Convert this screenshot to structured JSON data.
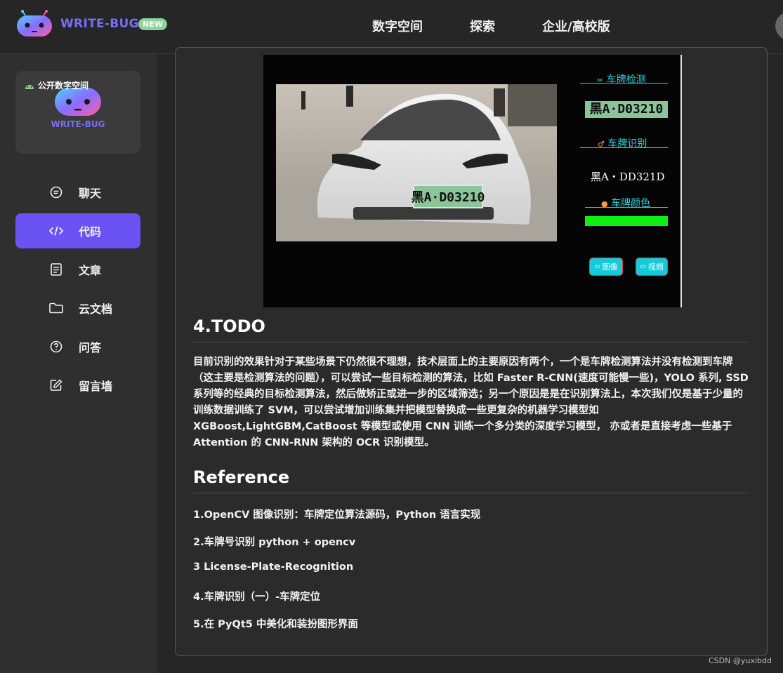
{
  "header": {
    "brand": "WRITE-BUG",
    "badge": "NEW",
    "nav": [
      "数字空间",
      "探索",
      "企业/高校版"
    ]
  },
  "sidebar": {
    "space_card": {
      "tag": "公开数字空间",
      "brand": "WRITE-BUG"
    },
    "items": [
      {
        "label": "聊天",
        "icon": "chat-icon",
        "active": false
      },
      {
        "label": "代码",
        "icon": "code-icon",
        "active": true
      },
      {
        "label": "文章",
        "icon": "article-icon",
        "active": false
      },
      {
        "label": "云文档",
        "icon": "folder-icon",
        "active": false
      },
      {
        "label": "问答",
        "icon": "question-icon",
        "active": false
      },
      {
        "label": "留言墙",
        "icon": "edit-icon",
        "active": false
      }
    ]
  },
  "app_screenshot": {
    "plate_photo_text": "黑A·D03210",
    "detect_label": "车牌检测",
    "detected_plate": "黑A·D03210",
    "recognize_label": "车牌识别",
    "recognized_text": "黑A・DD321D",
    "color_label": "车牌颜色",
    "plate_color": "#11ee11",
    "image_button": "图像",
    "video_button": "视频"
  },
  "article": {
    "todo_title": "4.TODO",
    "todo_text": "目前识别的效果针对于某些场景下仍然很不理想，技术层面上的主要原因有两个，一个是车牌检测算法并没有检测到车牌（这主要是检测算法的问题），可以尝试一些目标检测的算法，比如 Faster R-CNN(速度可能慢一些)，YOLO 系列, SSD 系列等的经典的目标检测算法，然后做矫正或进一步的区域筛选；另一个原因是是在识别算法上，本次我们仅是基于少量的训练数据训练了 SVM，可以尝试增加训练集并把模型替换成一些更复杂的机器学习模型如 XGBoost,LightGBM,CatBoost 等模型或使用 CNN 训练一个多分类的深度学习模型， 亦或者是直接考虑一些基于 Attention 的 CNN-RNN 架构的 OCR 识别模型。",
    "reference_title": "Reference",
    "references": [
      "1.OpenCV 图像识别：车牌定位算法源码，Python 语言实现",
      "2.车牌号识别 python + opencv",
      "3 License-Plate-Recognition",
      "4.车牌识别（一）-车牌定位",
      "5.在 PyQt5 中美化和装扮图形界面"
    ]
  },
  "watermark": "CSDN @yuxibdd",
  "colors": {
    "accent": "#6b52f3",
    "brand": "#7b6cf6",
    "badge": "#8fd19e",
    "cyan": "#27d6e0"
  }
}
